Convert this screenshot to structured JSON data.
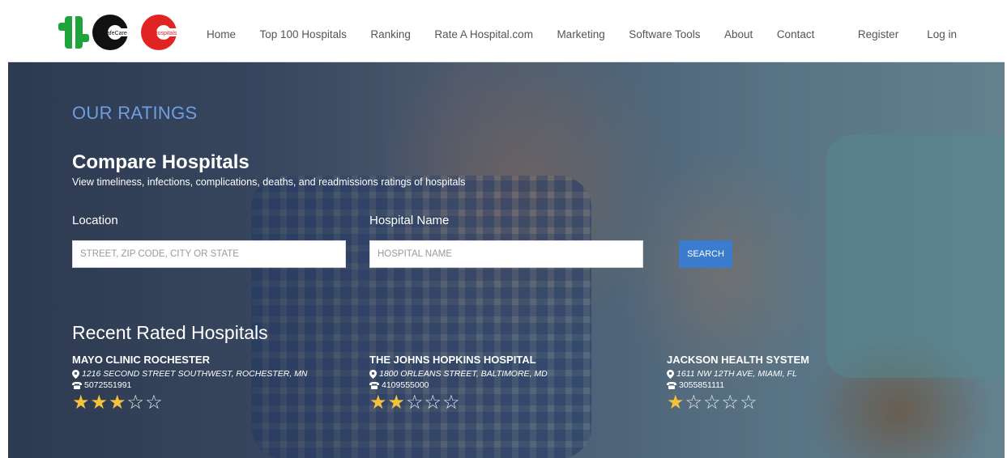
{
  "logo": {
    "text_main": "SCC",
    "text_left": "SafeCare",
    "text_right": "Hospitals"
  },
  "nav": {
    "items": [
      "Home",
      "Top 100 Hospitals",
      "Ranking",
      "Rate A Hospital.com",
      "Marketing",
      "Software Tools",
      "About",
      "Contact"
    ],
    "right": [
      "Register",
      "Log in"
    ]
  },
  "hero": {
    "section_label": "OUR RATINGS",
    "title": "Compare Hospitals",
    "subtitle": "View timeliness, infections, complications, deaths, and readmissions ratings of hospitals",
    "location_label": "Location",
    "location_placeholder": "STREET, ZIP CODE, CITY OR STATE",
    "hospital_label": "Hospital Name",
    "hospital_placeholder": "HOSPITAL NAME",
    "search_label": "SEARCH"
  },
  "recent": {
    "title": "Recent Rated Hospitals",
    "hospitals": [
      {
        "name": "MAYO CLINIC ROCHESTER",
        "address": "1216 SECOND STREET SOUTHWEST, ROCHESTER, MN",
        "phone": "5072551991",
        "rating": 3
      },
      {
        "name": "THE JOHNS HOPKINS HOSPITAL",
        "address": "1800 ORLEANS STREET, BALTIMORE, MD",
        "phone": "4109555000",
        "rating": 2
      },
      {
        "name": "JACKSON HEALTH SYSTEM",
        "address": "1611 NW 12TH AVE, MIAMI, FL",
        "phone": "3055851111",
        "rating": 1
      }
    ],
    "max_rating": 5
  },
  "colors": {
    "accent_blue": "#3b7ccf",
    "label_blue": "#6f9fe0",
    "star": "#f5c33b",
    "logo_green": "#1fa33a",
    "logo_red": "#e02424"
  },
  "icons": {
    "address": "map-marker-icon",
    "phone": "phone-icon"
  }
}
